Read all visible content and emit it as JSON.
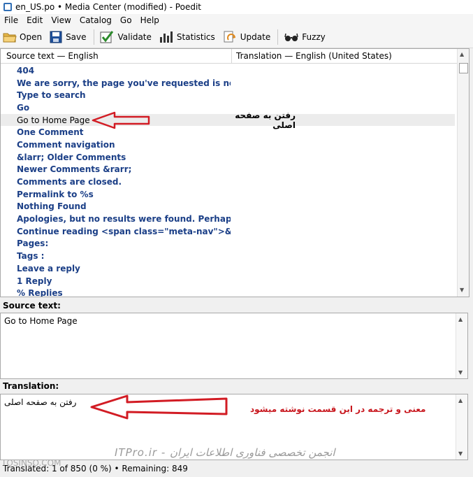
{
  "window": {
    "title": "en_US.po • Media Center (modified) - Poedit"
  },
  "menu": [
    "File",
    "Edit",
    "View",
    "Catalog",
    "Go",
    "Help"
  ],
  "toolbar": {
    "open": "Open",
    "save": "Save",
    "validate": "Validate",
    "statistics": "Statistics",
    "update": "Update",
    "fuzzy": "Fuzzy"
  },
  "list": {
    "header_source": "Source text — English",
    "header_translation": "Translation — English (United States)",
    "rows": [
      {
        "source": "404",
        "translation": ""
      },
      {
        "source": "We are sorry, the page you've requested is not available.",
        "translation": ""
      },
      {
        "source": "Type to search",
        "translation": ""
      },
      {
        "source": "Go",
        "translation": ""
      },
      {
        "source": "Go to Home Page",
        "translation": "رفتن به صفحه اصلی"
      },
      {
        "source": "One Comment",
        "translation": ""
      },
      {
        "source": "Comment navigation",
        "translation": ""
      },
      {
        "source": "&larr; Older Comments",
        "translation": ""
      },
      {
        "source": "Newer Comments &rarr;",
        "translation": ""
      },
      {
        "source": "Comments are closed.",
        "translation": ""
      },
      {
        "source": "Permalink to %s",
        "translation": ""
      },
      {
        "source": "Nothing Found",
        "translation": ""
      },
      {
        "source": "Apologies, but no results were found. Perhaps searching ...",
        "translation": ""
      },
      {
        "source": "Continue reading <span class=\"meta-nav\">&rarr;</span>",
        "translation": ""
      },
      {
        "source": "Pages:",
        "translation": ""
      },
      {
        "source": "Tags :",
        "translation": ""
      },
      {
        "source": "Leave a reply",
        "translation": ""
      },
      {
        "source": "1 Reply",
        "translation": ""
      },
      {
        "source": "% Replies",
        "translation": ""
      }
    ]
  },
  "source_panel": {
    "label": "Source text:",
    "text": "Go to Home Page"
  },
  "translation_panel": {
    "label": "Translation:",
    "text": "رفتن به صفحه اصلی"
  },
  "annotation_note": "معنی و ترجمه در این قسمت نوشته میشود",
  "watermark": "ITPro.ir - انجمن تخصصی فناوری اطلاعات ایران",
  "watermark2": "TOSINSO.COM",
  "status": {
    "text": "Translated: 1 of 850 (0 %)  •  Remaining: 849"
  },
  "colors": {
    "entry_text": "#1b3f87",
    "annotation": "#d21c24"
  }
}
